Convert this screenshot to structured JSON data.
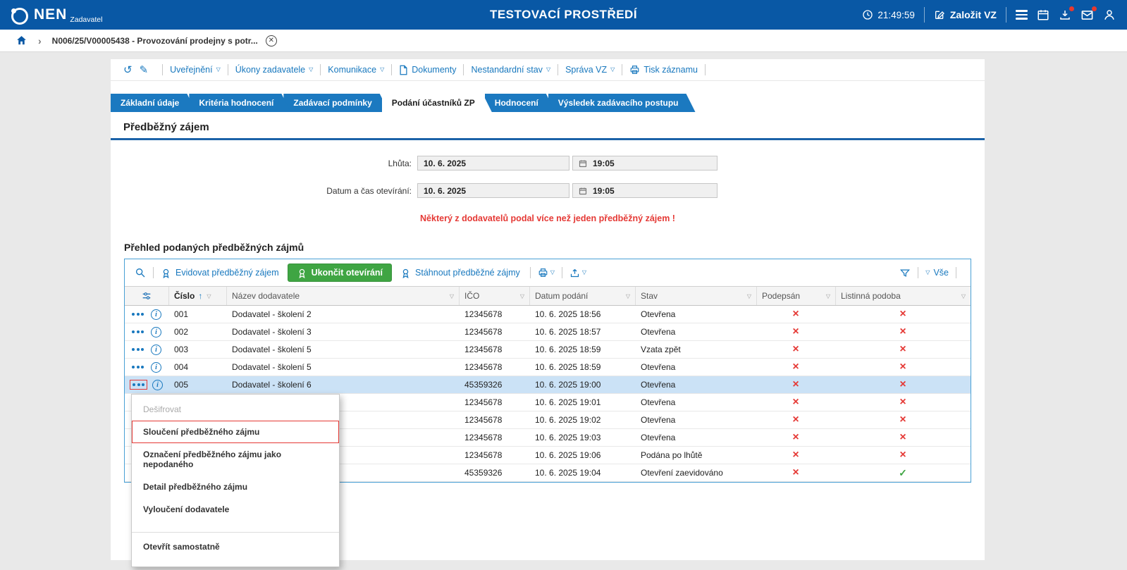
{
  "header": {
    "logo_text": "NEN",
    "logo_subtext": "Zadavatel",
    "environment_title": "TESTOVACÍ PROSTŘEDÍ",
    "clock": "21:49:59",
    "create_button": "Založit VZ"
  },
  "breadcrumb": {
    "tab_label": "N006/25/V00005438 - Provozování prodejny s potr..."
  },
  "record_toolbar": {
    "items": [
      {
        "label": "Uveřejnění"
      },
      {
        "label": "Úkony zadavatele"
      },
      {
        "label": "Komunikace"
      },
      {
        "label": "Dokumenty"
      },
      {
        "label": "Nestandardní stav"
      },
      {
        "label": "Správa VZ"
      },
      {
        "label": "Tisk záznamu"
      }
    ]
  },
  "tabs": [
    {
      "label": "Základní údaje",
      "active": false
    },
    {
      "label": "Kritéria hodnocení",
      "active": false
    },
    {
      "label": "Zadávací podmínky",
      "active": false
    },
    {
      "label": "Podání účastníků ZP",
      "active": true
    },
    {
      "label": "Hodnocení",
      "active": false
    },
    {
      "label": "Výsledek zadávacího postupu",
      "active": false
    }
  ],
  "section_title": "Předběžný zájem",
  "form": {
    "rows": [
      {
        "label": "Lhůta:",
        "date": "10. 6. 2025",
        "time": "19:05"
      },
      {
        "label": "Datum a čas otevírání:",
        "date": "10. 6. 2025",
        "time": "19:05"
      }
    ],
    "warning": "Některý z dodavatelů podal více než jeden předběžný zájem !"
  },
  "grid": {
    "title": "Přehled podaných předběžných zájmů",
    "toolbar": {
      "record_button": "Evidovat předběžný zájem",
      "finish_button": "Ukončit otevírání",
      "download_button": "Stáhnout předběžné zájmy",
      "filter_all": "Vše"
    },
    "columns": {
      "cislo": "Číslo",
      "nazev": "Název dodavatele",
      "ico": "IČO",
      "datum": "Datum podání",
      "stav": "Stav",
      "podepsan": "Podepsán",
      "listinna": "Listinná podoba"
    },
    "rows": [
      {
        "cislo": "001",
        "nazev": "Dodavatel - školení 2",
        "ico": "12345678",
        "datum": "10. 6. 2025 18:56",
        "stav": "Otevřena",
        "podepsan": false,
        "listinna": false,
        "selected": false
      },
      {
        "cislo": "002",
        "nazev": "Dodavatel - školení 3",
        "ico": "12345678",
        "datum": "10. 6. 2025 18:57",
        "stav": "Otevřena",
        "podepsan": false,
        "listinna": false,
        "selected": false
      },
      {
        "cislo": "003",
        "nazev": "Dodavatel - školení 5",
        "ico": "12345678",
        "datum": "10. 6. 2025 18:59",
        "stav": "Vzata zpět",
        "podepsan": false,
        "listinna": false,
        "selected": false
      },
      {
        "cislo": "004",
        "nazev": "Dodavatel - školení 5",
        "ico": "12345678",
        "datum": "10. 6. 2025 18:59",
        "stav": "Otevřena",
        "podepsan": false,
        "listinna": false,
        "selected": false
      },
      {
        "cislo": "005",
        "nazev": "Dodavatel - školení 6",
        "ico": "45359326",
        "datum": "10. 6. 2025 19:00",
        "stav": "Otevřena",
        "podepsan": false,
        "listinna": false,
        "selected": true
      },
      {
        "cislo": "",
        "nazev": "",
        "ico": "12345678",
        "datum": "10. 6. 2025 19:01",
        "stav": "Otevřena",
        "podepsan": false,
        "listinna": false,
        "selected": false
      },
      {
        "cislo": "",
        "nazev": "",
        "ico": "12345678",
        "datum": "10. 6. 2025 19:02",
        "stav": "Otevřena",
        "podepsan": false,
        "listinna": false,
        "selected": false
      },
      {
        "cislo": "",
        "nazev": "",
        "ico": "12345678",
        "datum": "10. 6. 2025 19:03",
        "stav": "Otevřena",
        "podepsan": false,
        "listinna": false,
        "selected": false
      },
      {
        "cislo": "",
        "nazev": "",
        "ico": "12345678",
        "datum": "10. 6. 2025 19:06",
        "stav": "Podána po lhůtě",
        "podepsan": false,
        "listinna": false,
        "selected": false
      },
      {
        "cislo": "",
        "nazev": "",
        "ico": "45359326",
        "datum": "10. 6. 2025 19:04",
        "stav": "Otevření zaevidováno",
        "podepsan": false,
        "listinna": true,
        "selected": false
      }
    ]
  },
  "context_menu": {
    "items": [
      {
        "label": "Dešifrovat",
        "disabled": true
      },
      {
        "label": "Sloučení předběžného zájmu",
        "highlighted": true
      },
      {
        "label": "Označení předběžného zájmu jako nepodaného"
      },
      {
        "label": "Detail předběžného zájmu"
      },
      {
        "label": "Vyloučení dodavatele"
      },
      {
        "label": "Otevřít samostatně",
        "separated": true
      }
    ]
  },
  "colors": {
    "header_blue": "#0958a5",
    "link_blue": "#1878be",
    "tab_blue": "#1b79c0",
    "green": "#3fa543",
    "red": "#e53935",
    "selected_row": "#cbe2f6"
  }
}
